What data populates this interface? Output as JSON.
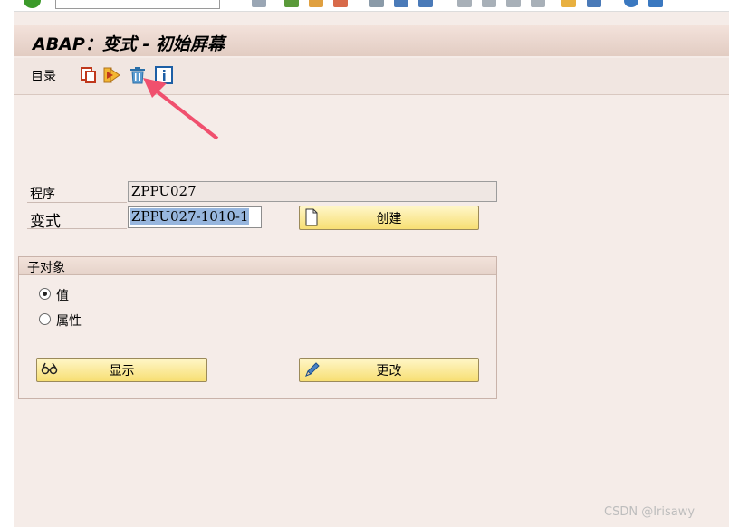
{
  "window": {
    "title": "ABAP：变式 - 初始屏幕"
  },
  "toolbar": {
    "menu_label": "目录",
    "icons": [
      "copy-icon",
      "execute-icon",
      "delete-icon",
      "info-icon"
    ]
  },
  "form": {
    "program_label": "程序",
    "program_value": "ZPPU027",
    "variant_label": "变式",
    "variant_value": "ZPPU027-1010-1",
    "create_button": "创建"
  },
  "subobjects": {
    "title": "子对象",
    "options": [
      {
        "label": "值",
        "selected": true
      },
      {
        "label": "属性",
        "selected": false
      }
    ],
    "display_button": "显示",
    "change_button": "更改"
  },
  "annotation": {
    "arrow_color": "#f0506e"
  },
  "watermark": "CSDN @Irisawy"
}
